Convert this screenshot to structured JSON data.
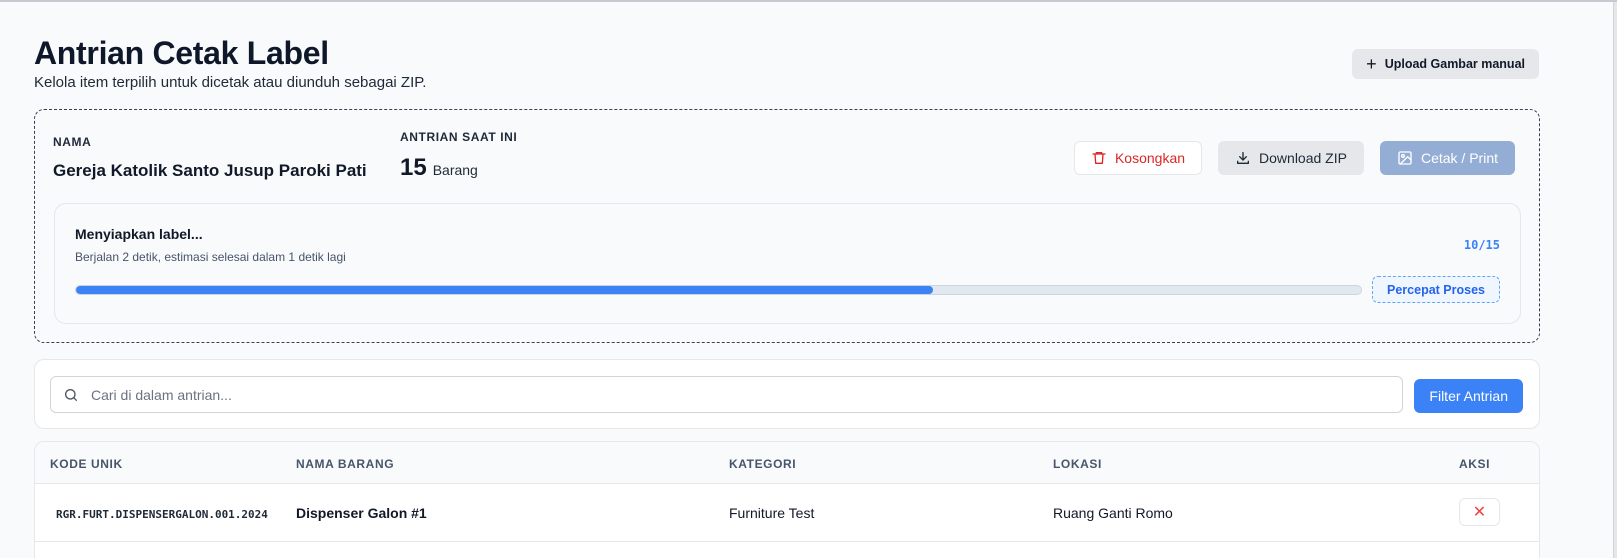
{
  "header": {
    "title": "Antrian Cetak Label",
    "subtitle": "Kelola item terpilih untuk dicetak atau diunduh sebagai ZIP.",
    "upload_label": "Upload Gambar manual"
  },
  "queue": {
    "name_label": "NAMA",
    "name_value": "Gereja Katolik Santo Jusup Paroki Pati",
    "current_label": "ANTRIAN SAAT INI",
    "current_count": "15",
    "current_unit": "Barang",
    "actions": {
      "clear_label": "Kosongkan",
      "download_label": "Download ZIP",
      "print_label": "Cetak / Print"
    }
  },
  "progress": {
    "title": "Menyiapkan label...",
    "detail": "Berjalan 2 detik, estimasi selesai dalam 1 detik lagi",
    "count_text": "10/15",
    "fraction": 0.667,
    "speedup_label": "Percepat Proses"
  },
  "search": {
    "placeholder": "Cari di dalam antrian...",
    "value": "",
    "filter_label": "Filter Antrian"
  },
  "table": {
    "columns": [
      "KODE UNIK",
      "NAMA BARANG",
      "KATEGORI",
      "LOKASI",
      "AKSI"
    ],
    "rows": [
      {
        "code": "RGR.FURT.DISPENSERGALON.001.2024",
        "name": "Dispenser Galon #1",
        "category": "Furniture Test",
        "location": "Ruang Ganti Romo",
        "action_icon": "x-icon"
      }
    ]
  },
  "colors": {
    "accent": "#3b82f6",
    "danger": "#dc2626",
    "print_disabled": "#93add4"
  }
}
